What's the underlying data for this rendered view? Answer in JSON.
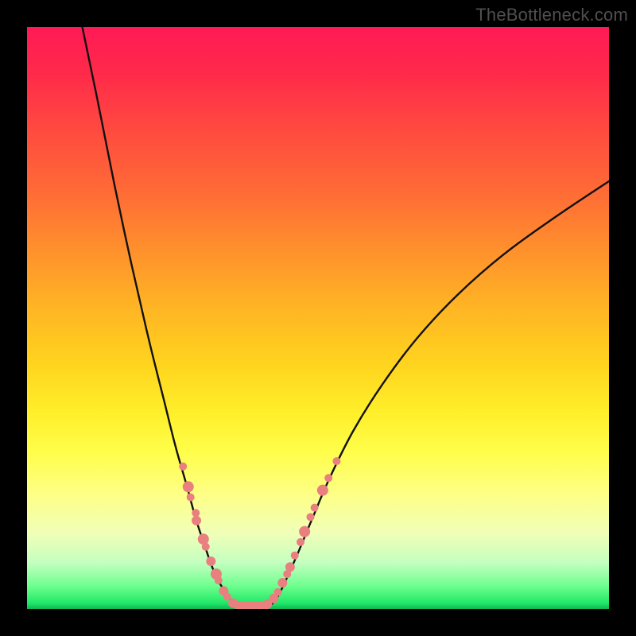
{
  "watermark": "TheBottleneck.com",
  "colors": {
    "background": "#000000",
    "curve": "#111111",
    "dot_fill": "#e97f7f",
    "dot_stroke": "#c95f5f",
    "gradient_top": "#ff1a55",
    "gradient_bottom": "#0fb552"
  },
  "chart_data": {
    "type": "line",
    "title": "",
    "xlabel": "",
    "ylabel": "",
    "xlim": [
      0,
      100
    ],
    "ylim": [
      0,
      100
    ],
    "note": "No axis ticks or numeric labels are visible in the image. x/y expressed as percent of plot width/height with y=0 at bottom. Curve values are estimated from gridless pixel positions.",
    "series": [
      {
        "name": "left-curve",
        "x": [
          9.5,
          12,
          15,
          18,
          21,
          23.5,
          25.5,
          27.5,
          29,
          30.5,
          31.7,
          32.8,
          34,
          35,
          35.8
        ],
        "y": [
          100,
          88,
          73,
          59,
          46,
          36,
          28,
          21,
          15.5,
          11,
          7.5,
          5,
          3,
          1.5,
          0.5
        ]
      },
      {
        "name": "valley-floor",
        "x": [
          35.8,
          36.5,
          37.3,
          38.2,
          39.1,
          40,
          40.9,
          41.7
        ],
        "y": [
          0.5,
          0.2,
          0.1,
          0.1,
          0.1,
          0.1,
          0.2,
          0.5
        ]
      },
      {
        "name": "right-curve",
        "x": [
          41.7,
          43,
          44.5,
          46.5,
          49,
          52,
          56,
          61,
          67,
          74,
          82,
          91,
          100
        ],
        "y": [
          0.5,
          2,
          5,
          9.5,
          15.5,
          22.5,
          30.5,
          38.5,
          46.5,
          54,
          61,
          67.5,
          73.5
        ]
      }
    ],
    "dots": {
      "note": "Salmon-colored scatter markers of varying radius clustered near the valley on both arms and along the bottom.",
      "points": [
        {
          "x": 26.8,
          "y": 24.5,
          "r": 5
        },
        {
          "x": 27.7,
          "y": 21.0,
          "r": 7
        },
        {
          "x": 28.1,
          "y": 19.2,
          "r": 5
        },
        {
          "x": 29.0,
          "y": 16.5,
          "r": 5
        },
        {
          "x": 29.1,
          "y": 15.2,
          "r": 6
        },
        {
          "x": 30.3,
          "y": 12.0,
          "r": 7
        },
        {
          "x": 30.7,
          "y": 10.7,
          "r": 5
        },
        {
          "x": 31.6,
          "y": 8.2,
          "r": 6
        },
        {
          "x": 32.5,
          "y": 6.0,
          "r": 7
        },
        {
          "x": 32.9,
          "y": 4.9,
          "r": 5
        },
        {
          "x": 33.8,
          "y": 3.1,
          "r": 6
        },
        {
          "x": 34.4,
          "y": 2.1,
          "r": 5
        },
        {
          "x": 35.4,
          "y": 1.0,
          "r": 6
        },
        {
          "x": 36.3,
          "y": 0.55,
          "r": 6
        },
        {
          "x": 37.3,
          "y": 0.55,
          "r": 6
        },
        {
          "x": 38.4,
          "y": 0.55,
          "r": 6
        },
        {
          "x": 39.5,
          "y": 0.55,
          "r": 6
        },
        {
          "x": 40.4,
          "y": 0.55,
          "r": 6
        },
        {
          "x": 41.3,
          "y": 0.8,
          "r": 6
        },
        {
          "x": 42.4,
          "y": 1.8,
          "r": 6
        },
        {
          "x": 43.1,
          "y": 2.9,
          "r": 5
        },
        {
          "x": 43.9,
          "y": 4.5,
          "r": 6
        },
        {
          "x": 44.7,
          "y": 6.0,
          "r": 5
        },
        {
          "x": 45.2,
          "y": 7.2,
          "r": 6
        },
        {
          "x": 46.0,
          "y": 9.2,
          "r": 5
        },
        {
          "x": 47.0,
          "y": 11.5,
          "r": 5
        },
        {
          "x": 47.7,
          "y": 13.3,
          "r": 7
        },
        {
          "x": 48.7,
          "y": 15.8,
          "r": 5
        },
        {
          "x": 49.4,
          "y": 17.4,
          "r": 5
        },
        {
          "x": 50.8,
          "y": 20.4,
          "r": 7
        },
        {
          "x": 51.8,
          "y": 22.5,
          "r": 5
        },
        {
          "x": 53.2,
          "y": 25.4,
          "r": 5
        }
      ]
    }
  }
}
